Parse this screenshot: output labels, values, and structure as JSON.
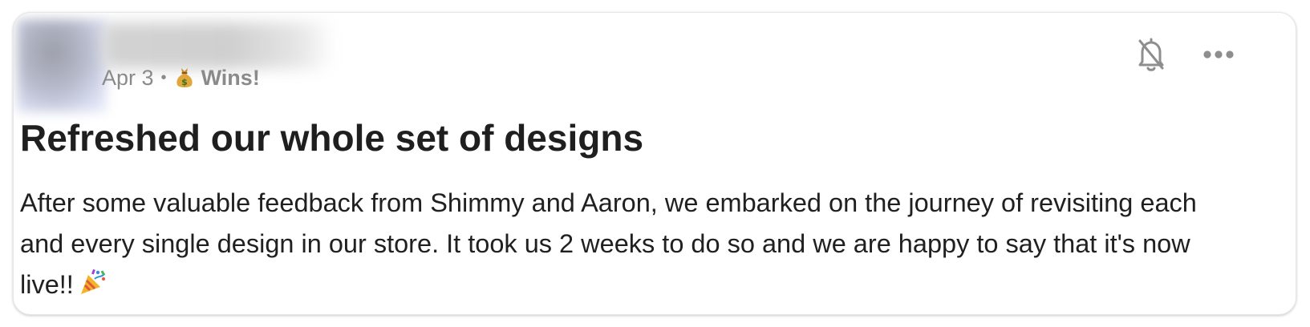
{
  "post": {
    "date": "Apr 3",
    "separator": "•",
    "category_emoji": "💰",
    "category": "Wins!",
    "title": "Refreshed our whole set of designs",
    "body_lines": [
      "After some valuable feedback from Shimmy and Aaron, we embarked on the journey of revisiting each",
      "and every single design in our store. It took us 2 weeks to do so and we are happy to say that it's now",
      "live!!"
    ],
    "body_end_emoji": "🎉"
  },
  "icons": {
    "bell": "bell-off-icon",
    "more": "more-horizontal-icon"
  },
  "colors": {
    "title": "#1f1f1f",
    "body": "#202020",
    "meta": "#8a8a8a",
    "icon": "#8e8e8e",
    "card_border": "#e6e6e6"
  }
}
